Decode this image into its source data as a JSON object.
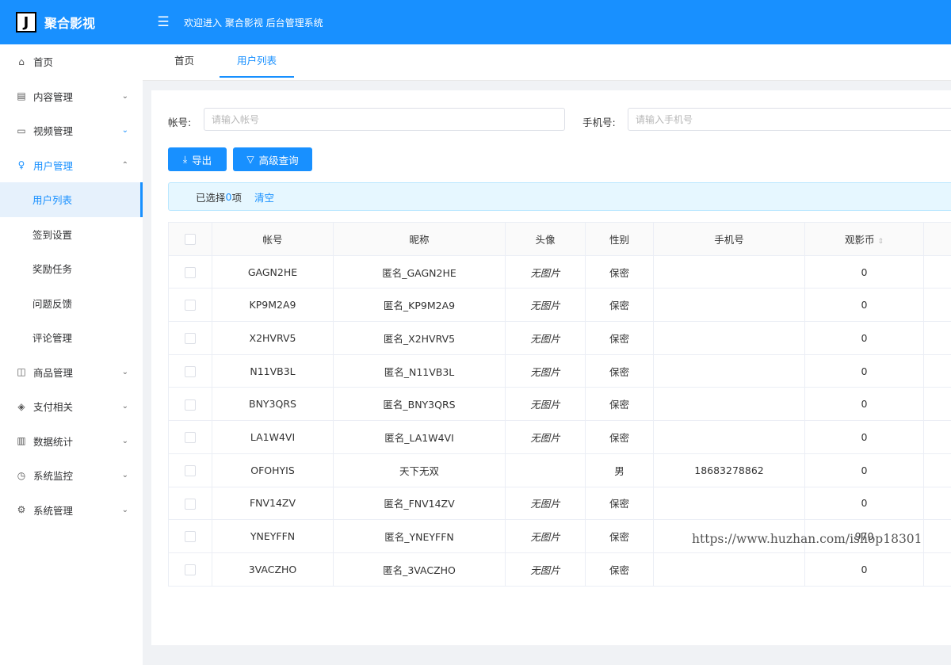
{
  "header": {
    "logo_letter": "J",
    "brand": "聚合影视",
    "menu_icon": "☰",
    "welcome": "欢迎进入 聚合影视 后台管理系统"
  },
  "sidebar": {
    "items": [
      {
        "label": "首页",
        "icon": "⌂",
        "icon_name": "home-icon"
      },
      {
        "label": "内容管理",
        "icon": "▤",
        "icon_name": "document-icon",
        "arrow": "⌄"
      },
      {
        "label": "视频管理",
        "icon": "▭",
        "icon_name": "video-icon",
        "arrow": "⌄"
      },
      {
        "label": "用户管理",
        "icon": "♀",
        "icon_name": "user-icon",
        "arrow": "⌃"
      },
      {
        "label": "商品管理",
        "icon": "◫",
        "icon_name": "shopping-bag-icon",
        "arrow": "⌄"
      },
      {
        "label": "支付相关",
        "icon": "◈",
        "icon_name": "shield-check-icon",
        "arrow": "⌄"
      },
      {
        "label": "数据统计",
        "icon": "▥",
        "icon_name": "bar-chart-icon",
        "arrow": "⌄"
      },
      {
        "label": "系统监控",
        "icon": "◷",
        "icon_name": "clock-icon",
        "arrow": "⌄"
      },
      {
        "label": "系统管理",
        "icon": "⚙",
        "icon_name": "gear-icon",
        "arrow": "⌄"
      }
    ],
    "sub_items": [
      "用户列表",
      "签到设置",
      "奖励任务",
      "问题反馈",
      "评论管理"
    ]
  },
  "tabs": [
    {
      "label": "首页"
    },
    {
      "label": "用户列表"
    }
  ],
  "filters": {
    "account_label": "帐号:",
    "account_placeholder": "请输入帐号",
    "account_value": "",
    "phone_label": "手机号:",
    "phone_placeholder": "请输入手机号",
    "phone_value": ""
  },
  "buttons": {
    "export_icon": "⤓",
    "export": "导出",
    "advanced_icon": "▽",
    "advanced": "高级查询"
  },
  "selection": {
    "prefix": "已选择 ",
    "count": "0",
    "suffix": "项",
    "clear": "清空"
  },
  "table": {
    "headers": [
      "帐号",
      "昵称",
      "头像",
      "性别",
      "手机号",
      "观影币"
    ],
    "sort_icon": "⇕",
    "rows": [
      {
        "account": "GAGN2HE",
        "nickname": "匿名_GAGN2HE",
        "avatar": "无图片",
        "gender": "保密",
        "phone": "",
        "coins": "0"
      },
      {
        "account": "KP9M2A9",
        "nickname": "匿名_KP9M2A9",
        "avatar": "无图片",
        "gender": "保密",
        "phone": "",
        "coins": "0"
      },
      {
        "account": "X2HVRV5",
        "nickname": "匿名_X2HVRV5",
        "avatar": "无图片",
        "gender": "保密",
        "phone": "",
        "coins": "0"
      },
      {
        "account": "N11VB3L",
        "nickname": "匿名_N11VB3L",
        "avatar": "无图片",
        "gender": "保密",
        "phone": "",
        "coins": "0"
      },
      {
        "account": "BNY3QRS",
        "nickname": "匿名_BNY3QRS",
        "avatar": "无图片",
        "gender": "保密",
        "phone": "",
        "coins": "0"
      },
      {
        "account": "LA1W4VI",
        "nickname": "匿名_LA1W4VI",
        "avatar": "无图片",
        "gender": "保密",
        "phone": "",
        "coins": "0"
      },
      {
        "account": "OFOHYIS",
        "nickname": "天下无双",
        "avatar": "",
        "gender": "男",
        "phone": "18683278862",
        "coins": "0"
      },
      {
        "account": "FNV14ZV",
        "nickname": "匿名_FNV14ZV",
        "avatar": "无图片",
        "gender": "保密",
        "phone": "",
        "coins": "0"
      },
      {
        "account": "YNEYFFN",
        "nickname": "匿名_YNEYFFN",
        "avatar": "无图片",
        "gender": "保密",
        "phone": "",
        "coins": "970"
      },
      {
        "account": "3VACZHO",
        "nickname": "匿名_3VACZHO",
        "avatar": "无图片",
        "gender": "保密",
        "phone": "",
        "coins": "0"
      }
    ]
  },
  "watermark": "https://www.huzhan.com/ishop18301",
  "colors": {
    "primary": "#1890ff",
    "alert_bg": "#e6f7ff",
    "active_bg": "#e6f1fc"
  }
}
